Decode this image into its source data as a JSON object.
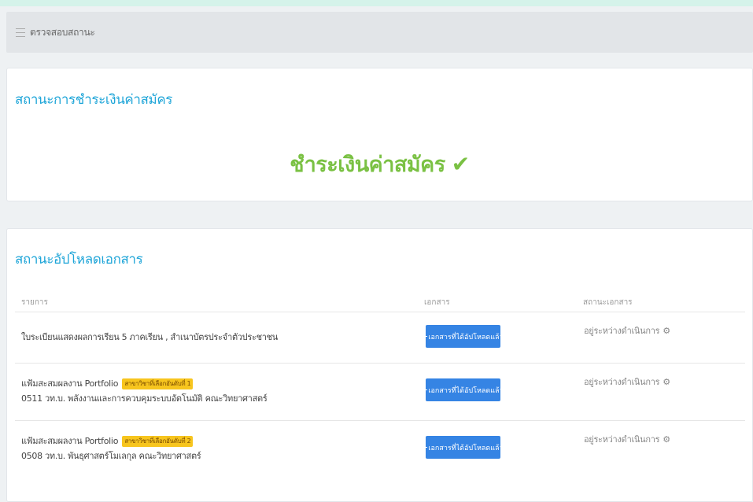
{
  "header": {
    "title": "ตรวจสอบสถานะ",
    "icon": "list-icon"
  },
  "payment": {
    "title": "สถานะการชำระเงินค่าสมัคร",
    "status_text": "ชำระเงินค่าสมัคร",
    "status_icon": "check-icon",
    "status_color": "#7ac143"
  },
  "upload": {
    "title": "สถานะอัปโหลดเอกสาร",
    "columns": [
      "รายการ",
      "เอกสาร",
      "สถานะเอกสาร"
    ],
    "rows": [
      {
        "line1": "ใบระเบียนแสดงผลการเรียน 5 ภาคเรียน , สำเนาบัตรประจำตัวประชาชน",
        "badge": "",
        "line2": "",
        "button": "เอกสารที่ได้อัปโหลดแล้ว",
        "status": "อยู่ระหว่างดำเนินการ"
      },
      {
        "line1": "แฟ้มสะสมผลงาน Portfolio",
        "badge": "สาขาวิชาที่เลือกอันดับที่ 1",
        "line2": "0511 วท.บ. พลังงานและการควบคุมระบบอัตโนมัติ คณะวิทยาศาสตร์",
        "button": "เอกสารที่ได้อัปโหลดแล้ว",
        "status": "อยู่ระหว่างดำเนินการ"
      },
      {
        "line1": "แฟ้มสะสมผลงาน Portfolio",
        "badge": "สาขาวิชาที่เลือกอันดับที่ 2",
        "line2": "0508 วท.บ. พันธุศาสตร์โมเลกุล คณะวิทยาศาสตร์",
        "button": "เอกสารที่ได้อัปโหลดแล้ว",
        "status": "อยู่ระหว่างดำเนินการ"
      }
    ]
  },
  "colors": {
    "accent": "#1ea5d8",
    "button": "#3584e4",
    "badge": "#f7c51e"
  }
}
